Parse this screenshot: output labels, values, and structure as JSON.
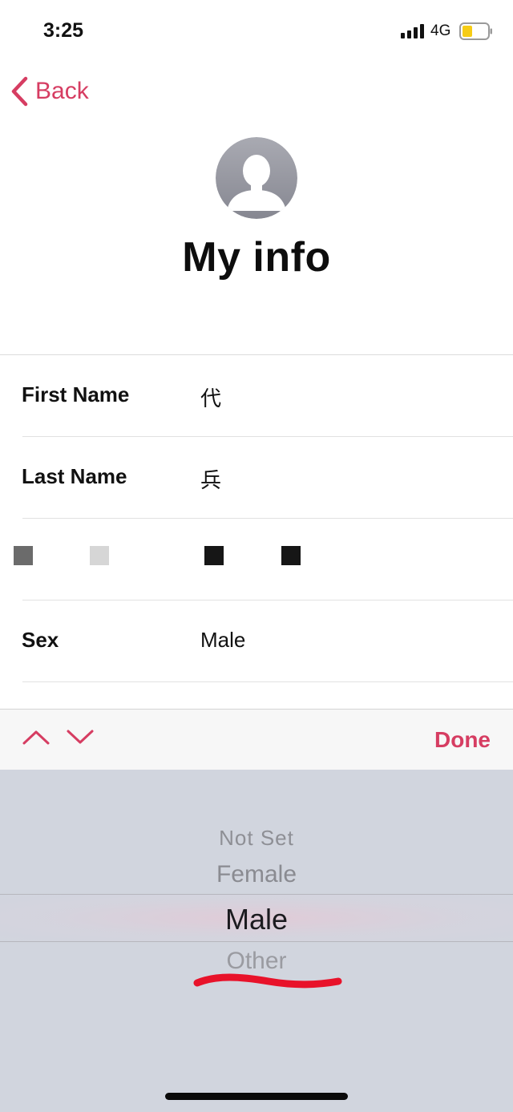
{
  "status_bar": {
    "time": "3:25",
    "network": "4G",
    "icons": [
      "signal-icon",
      "battery-icon"
    ]
  },
  "nav": {
    "back_label": "Back",
    "back_icon": "chevron-left-icon"
  },
  "profile": {
    "avatar_icon": "person-silhouette-icon",
    "title": "My info"
  },
  "form": {
    "rows": [
      {
        "label": "First Name",
        "value": "代"
      },
      {
        "label": "Last Name",
        "value": "兵"
      },
      {
        "label": "",
        "value": ""
      },
      {
        "label": "Sex",
        "value": "Male"
      }
    ]
  },
  "toolbar": {
    "prev_icon": "chevron-up-icon",
    "next_icon": "chevron-down-icon",
    "done_label": "Done"
  },
  "picker": {
    "options": [
      "Not Set",
      "Female",
      "Male",
      "Other"
    ],
    "selected": "Male"
  },
  "colors": {
    "accent": "#d63d62",
    "picker_bg": "#d1d5de",
    "annotation": "#e8122a"
  }
}
